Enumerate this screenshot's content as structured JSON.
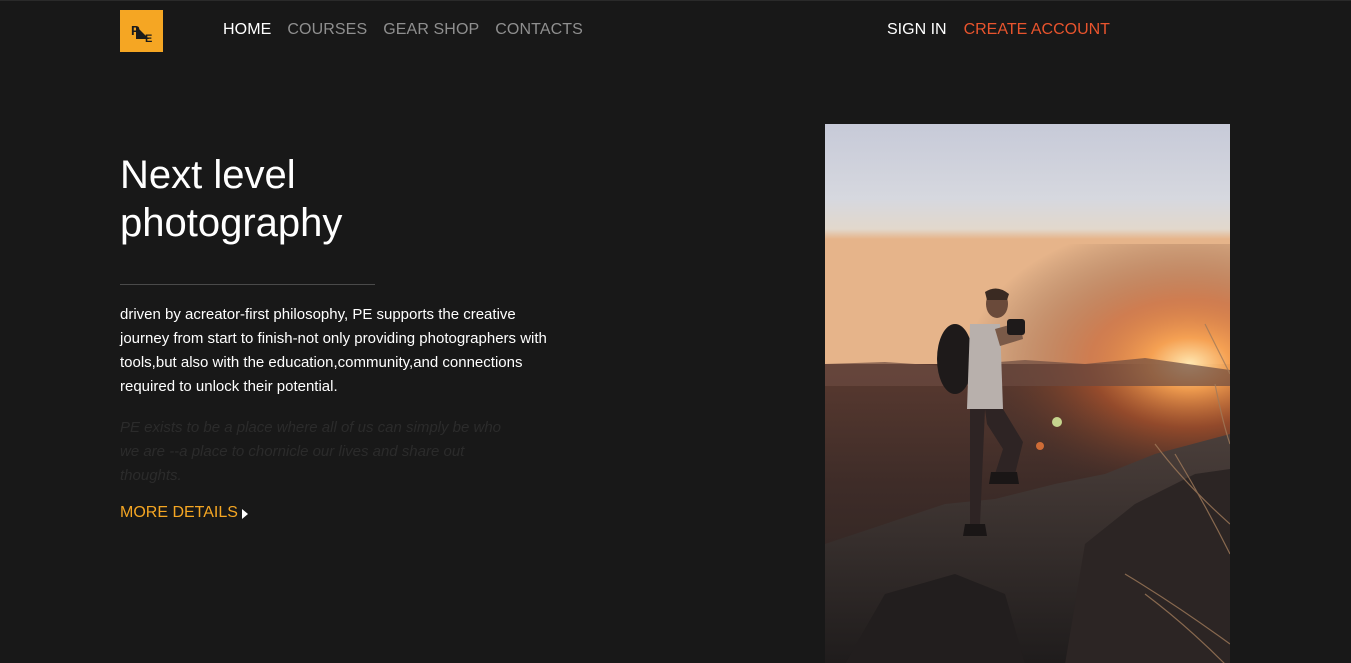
{
  "logo": {
    "letters": [
      "P",
      "E"
    ],
    "icon": "pe-logo-icon",
    "bg_color": "#f5a623"
  },
  "nav": {
    "items": [
      {
        "label": "HOME",
        "active": true
      },
      {
        "label": "COURSES",
        "active": false
      },
      {
        "label": "GEAR SHOP",
        "active": false
      },
      {
        "label": "CONTACTS",
        "active": false
      }
    ]
  },
  "auth": {
    "sign_in": "SIGN IN",
    "create_account": "CREATE ACCOUNT",
    "create_color": "#e8542d"
  },
  "hero": {
    "title_line1": "Next level",
    "title_line2": "photography",
    "description": "driven by acreator-first philosophy, PE supports the creative journey from start to finish-not only providing photographers with tools,but also with the education,community,and connections required to unlock their potential.",
    "faded_text": "PE exists to be a place where all of us can simply be who we are --a place to chornicle our lives and share out thoughts.",
    "more_link": "MORE DETAILS",
    "more_icon": "caret-right-icon",
    "accent_color": "#f5a623"
  },
  "photo": {
    "subject": "hiker-photographer-at-sunset-image"
  }
}
